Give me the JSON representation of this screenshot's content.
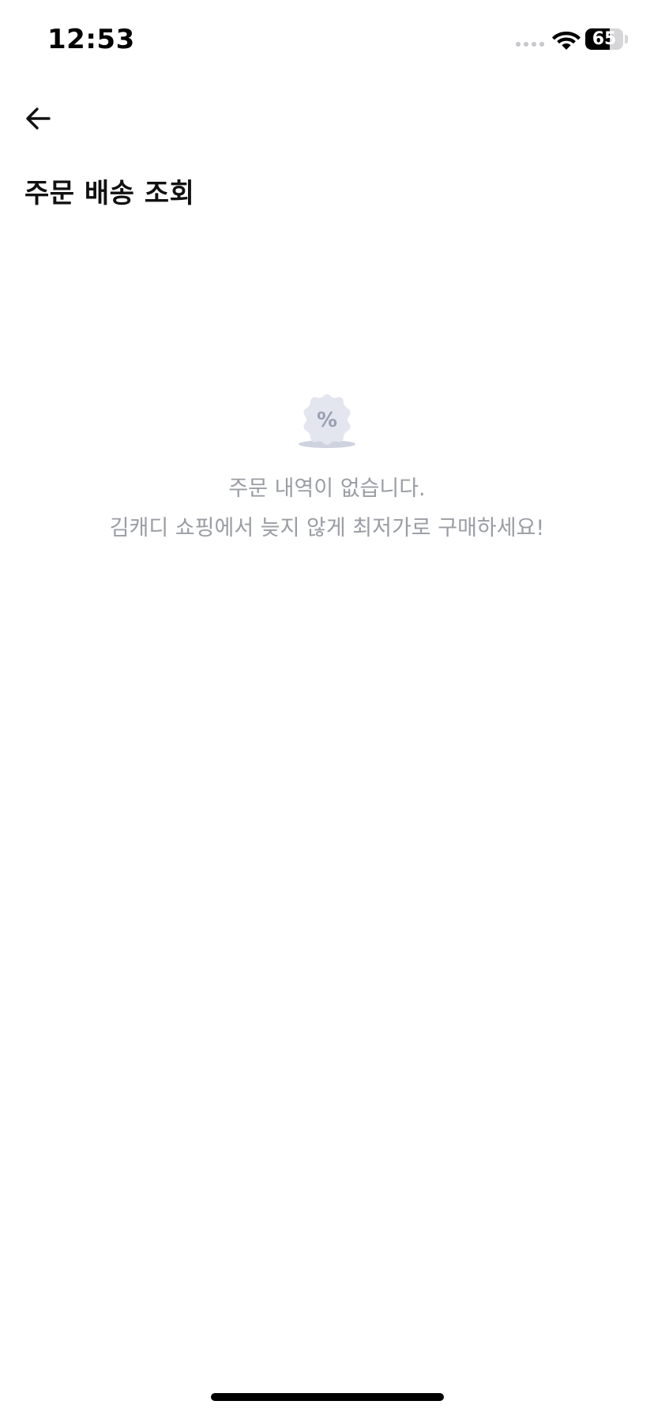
{
  "status_bar": {
    "time": "12:53",
    "battery_level": "65",
    "battery_fraction": 0.65,
    "signal_icon": "cellular-dots-icon",
    "wifi_icon": "wifi-icon",
    "battery_icon": "battery-icon"
  },
  "header": {
    "back_icon": "arrow-left-icon",
    "title": "주문 배송 조회"
  },
  "empty_state": {
    "icon": "discount-badge-icon",
    "icon_glyph": "%",
    "message_line1": "주문 내역이 없습니다.",
    "message_line2": "김캐디 쇼핑에서 늦지 않게 최저가로 구매하세요!"
  },
  "colors": {
    "background": "#ffffff",
    "text_primary": "#111111",
    "text_muted": "#9a9da3",
    "icon_badge": "#e3e6ef",
    "icon_symbol": "#9aa0b4",
    "icon_shadow": "#cfd3e0"
  }
}
